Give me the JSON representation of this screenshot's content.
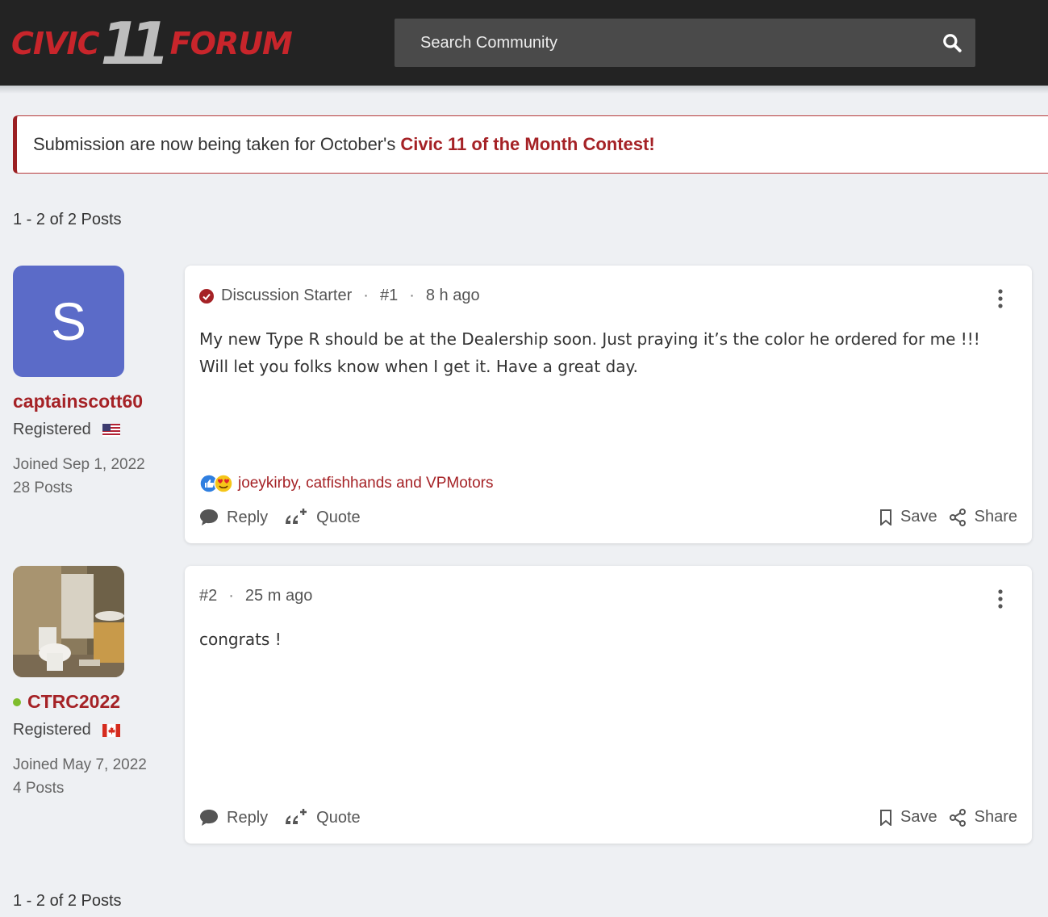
{
  "header": {
    "logo": {
      "civic": "CIVIC",
      "eleven": "11",
      "forum": "FORUM"
    },
    "search": {
      "placeholder": "Search Community",
      "icon": "search-icon"
    }
  },
  "announcement": {
    "text": "Submission are now being taken for October's",
    "link": "Civic 11 of the Month Contest!"
  },
  "pagination": {
    "top": "1 - 2 of 2 Posts",
    "bottom": "1 - 2 of 2 Posts"
  },
  "posts": [
    {
      "user": {
        "name": "captainscott60",
        "avatar_letter": "S",
        "avatar_color": "#5b6bc8",
        "role": "Registered",
        "flag": "us-flag-icon",
        "joined": "Joined Sep 1, 2022",
        "posts": "28 Posts",
        "online": false
      },
      "badge": "Discussion Starter",
      "number": "#1",
      "time": "8 h ago",
      "body": "My new Type R should be at the Dealership soon. Just praying it’s the color he ordered for me !!! Will let you folks know when I get it. Have a great day.",
      "reactions": "joeykirby, catfishhands and VPMotors",
      "actions": {
        "reply": "Reply",
        "quote": "Quote",
        "save": "Save",
        "share": "Share"
      }
    },
    {
      "user": {
        "name": "CTRC2022",
        "avatar": "bathroom-photo",
        "role": "Registered",
        "flag": "ca-flag-icon",
        "joined": "Joined May 7, 2022",
        "posts": "4 Posts",
        "online": true
      },
      "number": "#2",
      "time": "25 m ago",
      "body": "congrats !",
      "actions": {
        "reply": "Reply",
        "quote": "Quote",
        "save": "Save",
        "share": "Share"
      }
    }
  ],
  "colors": {
    "brand": "#a52226",
    "header_bg": "#232323",
    "online": "#7ebd2c"
  }
}
